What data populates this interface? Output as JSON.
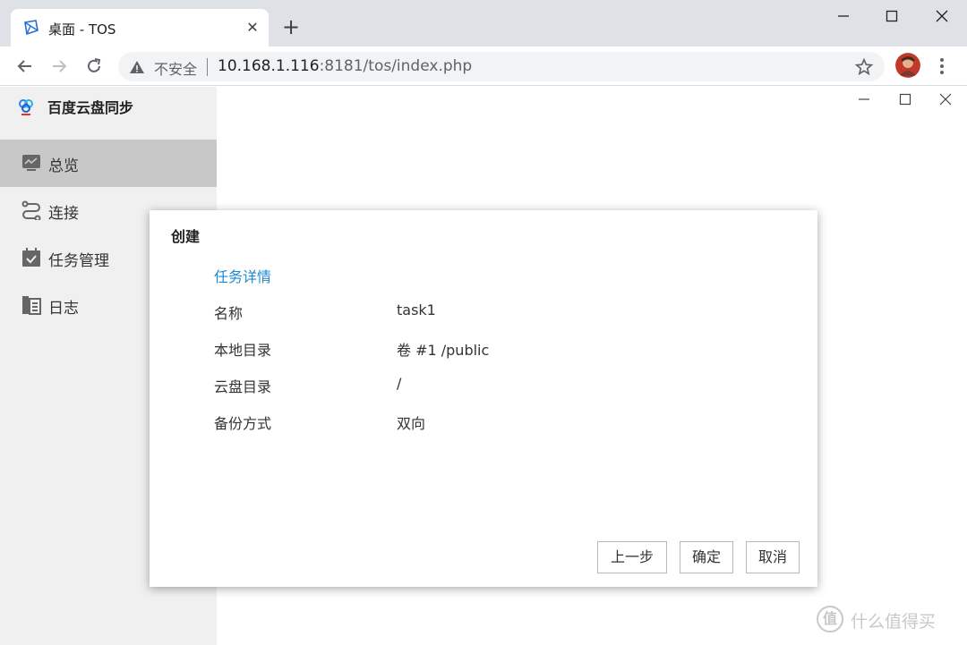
{
  "browser": {
    "tab_title": "桌面 - TOS",
    "new_tab": "+",
    "security_label": "不安全",
    "url_host": "10.168.1.116",
    "url_rest": ":8181/tos/index.php"
  },
  "app": {
    "title": "百度云盘同步",
    "nav": [
      {
        "label": "总览",
        "icon": "monitor-icon",
        "active": true
      },
      {
        "label": "连接",
        "icon": "link-icon",
        "active": false
      },
      {
        "label": "任务管理",
        "icon": "calendar-check-icon",
        "active": false
      },
      {
        "label": "日志",
        "icon": "log-icon",
        "active": false
      }
    ]
  },
  "dialog": {
    "title": "创建",
    "section": "任务详情",
    "rows": [
      {
        "label": "名称",
        "value": "task1"
      },
      {
        "label": "本地目录",
        "value": "卷 #1 /public"
      },
      {
        "label": "云盘目录",
        "value": "/"
      },
      {
        "label": "备份方式",
        "value": "双向"
      }
    ],
    "buttons": {
      "prev": "上一步",
      "ok": "确定",
      "cancel": "取消"
    }
  },
  "watermark": {
    "logo": "值",
    "text": "什么值得买"
  }
}
